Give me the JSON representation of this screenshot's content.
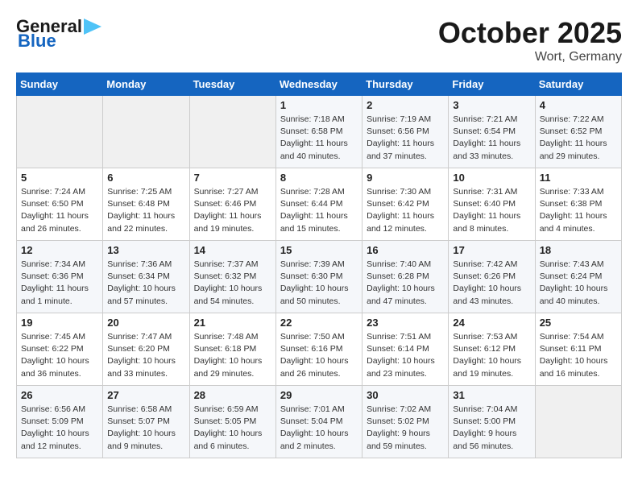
{
  "header": {
    "logo_general": "General",
    "logo_blue": "Blue",
    "month": "October 2025",
    "location": "Wort, Germany"
  },
  "weekdays": [
    "Sunday",
    "Monday",
    "Tuesday",
    "Wednesday",
    "Thursday",
    "Friday",
    "Saturday"
  ],
  "weeks": [
    [
      {
        "day": "",
        "data": ""
      },
      {
        "day": "",
        "data": ""
      },
      {
        "day": "",
        "data": ""
      },
      {
        "day": "1",
        "data": "Sunrise: 7:18 AM\nSunset: 6:58 PM\nDaylight: 11 hours\nand 40 minutes."
      },
      {
        "day": "2",
        "data": "Sunrise: 7:19 AM\nSunset: 6:56 PM\nDaylight: 11 hours\nand 37 minutes."
      },
      {
        "day": "3",
        "data": "Sunrise: 7:21 AM\nSunset: 6:54 PM\nDaylight: 11 hours\nand 33 minutes."
      },
      {
        "day": "4",
        "data": "Sunrise: 7:22 AM\nSunset: 6:52 PM\nDaylight: 11 hours\nand 29 minutes."
      }
    ],
    [
      {
        "day": "5",
        "data": "Sunrise: 7:24 AM\nSunset: 6:50 PM\nDaylight: 11 hours\nand 26 minutes."
      },
      {
        "day": "6",
        "data": "Sunrise: 7:25 AM\nSunset: 6:48 PM\nDaylight: 11 hours\nand 22 minutes."
      },
      {
        "day": "7",
        "data": "Sunrise: 7:27 AM\nSunset: 6:46 PM\nDaylight: 11 hours\nand 19 minutes."
      },
      {
        "day": "8",
        "data": "Sunrise: 7:28 AM\nSunset: 6:44 PM\nDaylight: 11 hours\nand 15 minutes."
      },
      {
        "day": "9",
        "data": "Sunrise: 7:30 AM\nSunset: 6:42 PM\nDaylight: 11 hours\nand 12 minutes."
      },
      {
        "day": "10",
        "data": "Sunrise: 7:31 AM\nSunset: 6:40 PM\nDaylight: 11 hours\nand 8 minutes."
      },
      {
        "day": "11",
        "data": "Sunrise: 7:33 AM\nSunset: 6:38 PM\nDaylight: 11 hours\nand 4 minutes."
      }
    ],
    [
      {
        "day": "12",
        "data": "Sunrise: 7:34 AM\nSunset: 6:36 PM\nDaylight: 11 hours\nand 1 minute."
      },
      {
        "day": "13",
        "data": "Sunrise: 7:36 AM\nSunset: 6:34 PM\nDaylight: 10 hours\nand 57 minutes."
      },
      {
        "day": "14",
        "data": "Sunrise: 7:37 AM\nSunset: 6:32 PM\nDaylight: 10 hours\nand 54 minutes."
      },
      {
        "day": "15",
        "data": "Sunrise: 7:39 AM\nSunset: 6:30 PM\nDaylight: 10 hours\nand 50 minutes."
      },
      {
        "day": "16",
        "data": "Sunrise: 7:40 AM\nSunset: 6:28 PM\nDaylight: 10 hours\nand 47 minutes."
      },
      {
        "day": "17",
        "data": "Sunrise: 7:42 AM\nSunset: 6:26 PM\nDaylight: 10 hours\nand 43 minutes."
      },
      {
        "day": "18",
        "data": "Sunrise: 7:43 AM\nSunset: 6:24 PM\nDaylight: 10 hours\nand 40 minutes."
      }
    ],
    [
      {
        "day": "19",
        "data": "Sunrise: 7:45 AM\nSunset: 6:22 PM\nDaylight: 10 hours\nand 36 minutes."
      },
      {
        "day": "20",
        "data": "Sunrise: 7:47 AM\nSunset: 6:20 PM\nDaylight: 10 hours\nand 33 minutes."
      },
      {
        "day": "21",
        "data": "Sunrise: 7:48 AM\nSunset: 6:18 PM\nDaylight: 10 hours\nand 29 minutes."
      },
      {
        "day": "22",
        "data": "Sunrise: 7:50 AM\nSunset: 6:16 PM\nDaylight: 10 hours\nand 26 minutes."
      },
      {
        "day": "23",
        "data": "Sunrise: 7:51 AM\nSunset: 6:14 PM\nDaylight: 10 hours\nand 23 minutes."
      },
      {
        "day": "24",
        "data": "Sunrise: 7:53 AM\nSunset: 6:12 PM\nDaylight: 10 hours\nand 19 minutes."
      },
      {
        "day": "25",
        "data": "Sunrise: 7:54 AM\nSunset: 6:11 PM\nDaylight: 10 hours\nand 16 minutes."
      }
    ],
    [
      {
        "day": "26",
        "data": "Sunrise: 6:56 AM\nSunset: 5:09 PM\nDaylight: 10 hours\nand 12 minutes."
      },
      {
        "day": "27",
        "data": "Sunrise: 6:58 AM\nSunset: 5:07 PM\nDaylight: 10 hours\nand 9 minutes."
      },
      {
        "day": "28",
        "data": "Sunrise: 6:59 AM\nSunset: 5:05 PM\nDaylight: 10 hours\nand 6 minutes."
      },
      {
        "day": "29",
        "data": "Sunrise: 7:01 AM\nSunset: 5:04 PM\nDaylight: 10 hours\nand 2 minutes."
      },
      {
        "day": "30",
        "data": "Sunrise: 7:02 AM\nSunset: 5:02 PM\nDaylight: 9 hours\nand 59 minutes."
      },
      {
        "day": "31",
        "data": "Sunrise: 7:04 AM\nSunset: 5:00 PM\nDaylight: 9 hours\nand 56 minutes."
      },
      {
        "day": "",
        "data": ""
      }
    ]
  ]
}
